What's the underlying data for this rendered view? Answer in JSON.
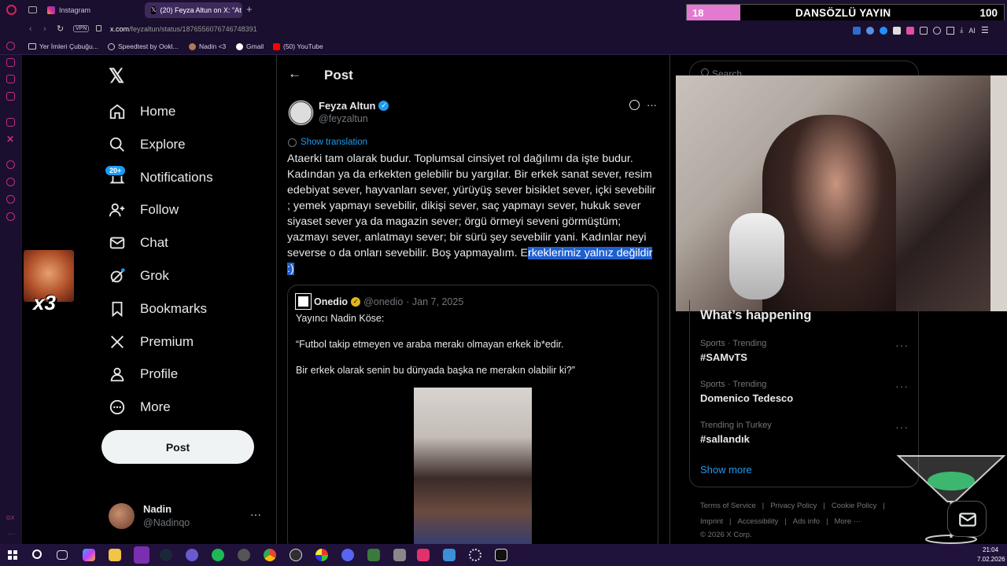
{
  "browser": {
    "tabs": [
      {
        "label": "Instagram"
      },
      {
        "label": "(20) Feyza Altun on X: \"At"
      }
    ],
    "url_domain": "x.com",
    "url_path": "/feyzaltun/status/1876556076746748391",
    "vpn_label": "VPN",
    "bookmarks": [
      "Yer İmleri Çubuğu...",
      "Speedtest by Ookl...",
      "Nadin <3",
      "Gmail",
      "(50) YouTube"
    ],
    "extensions_ai_label": "AI"
  },
  "stream_overlay": {
    "counter_left": "18",
    "title": "DANSÖZLÜ YAYIN",
    "counter_right": "100",
    "multiplier": "x3"
  },
  "nav": {
    "items": [
      {
        "label": "Home",
        "icon": "home-icon"
      },
      {
        "label": "Explore",
        "icon": "search-icon"
      },
      {
        "label": "Notifications",
        "icon": "bell-icon",
        "badge": "20+"
      },
      {
        "label": "Follow",
        "icon": "follow-icon"
      },
      {
        "label": "Chat",
        "icon": "mail-icon"
      },
      {
        "label": "Grok",
        "icon": "grok-icon"
      },
      {
        "label": "Bookmarks",
        "icon": "bookmark-icon"
      },
      {
        "label": "Premium",
        "icon": "x-logo-icon"
      },
      {
        "label": "Profile",
        "icon": "person-icon"
      },
      {
        "label": "More",
        "icon": "more-circle-icon"
      }
    ],
    "post_button": "Post",
    "account": {
      "name": "Nadin",
      "handle": "@Nadinqo"
    }
  },
  "post": {
    "header_title": "Post",
    "author_name": "Feyza Altun",
    "author_handle": "@feyzaltun",
    "show_translation": "Show translation",
    "text_before": "Ataerki tam olarak budur. Toplumsal cinsiyet rol dağılımı da işte budur. Kadından ya da erkekten gelebilir bu yargılar. Bir erkek sanat sever, resim edebiyat sever, hayvanları sever, yürüyüş sever bisiklet sever, içki sevebilir ; yemek yapmayı sevebilir, dikişi sever, saç yapmayı sever, hukuk sever siyaset sever ya da magazin sever; örgü örmeyi seveni görmüştüm; yazmayı sever, anlatmayı sever; bir sürü şey sevebilir yani. Kadınlar neyi severse o da onları sevebilir. Boş yapmayalım. E",
    "text_highlight": "rkeklerimiz yalnız değildir :)",
    "quote": {
      "author_name": "Onedio",
      "author_handle": "@onedio",
      "date": "· Jan 7, 2025",
      "line1": "Yayıncı Nadin Köse:",
      "line2": "“Futbol takip etmeyen ve araba merakı olmayan erkek ib*edir.",
      "line3": "Bir erkek olarak senin bu dünyada başka ne merakın olabilir ki?”"
    }
  },
  "sidebar": {
    "search_placeholder": "Search",
    "whats_happening": "What’s happening",
    "trends": [
      {
        "meta": "Sports · Trending",
        "name": "#SAMvTS"
      },
      {
        "meta": "Sports · Trending",
        "name": "Domenico Tedesco"
      },
      {
        "meta": "Trending in Turkey",
        "name": "#sallandık"
      }
    ],
    "show_more": "Show more",
    "footer": {
      "row1": [
        "Terms of Service",
        "|",
        "Privacy Policy",
        "|",
        "Cookie Policy",
        "|"
      ],
      "row2": [
        "Imprint",
        "|",
        "Accessibility",
        "|",
        "Ads info",
        "|",
        "More ···"
      ],
      "copyright": "© 2026 X Corp."
    }
  },
  "taskbar": {
    "time": "21:04",
    "date": "7.02.2026"
  },
  "colors": {
    "accent_blue": "#1d9bf0",
    "highlight": "#1f5fcf",
    "browser_bg": "#1a0f2e",
    "overlay_pink": "#e27bd0"
  }
}
